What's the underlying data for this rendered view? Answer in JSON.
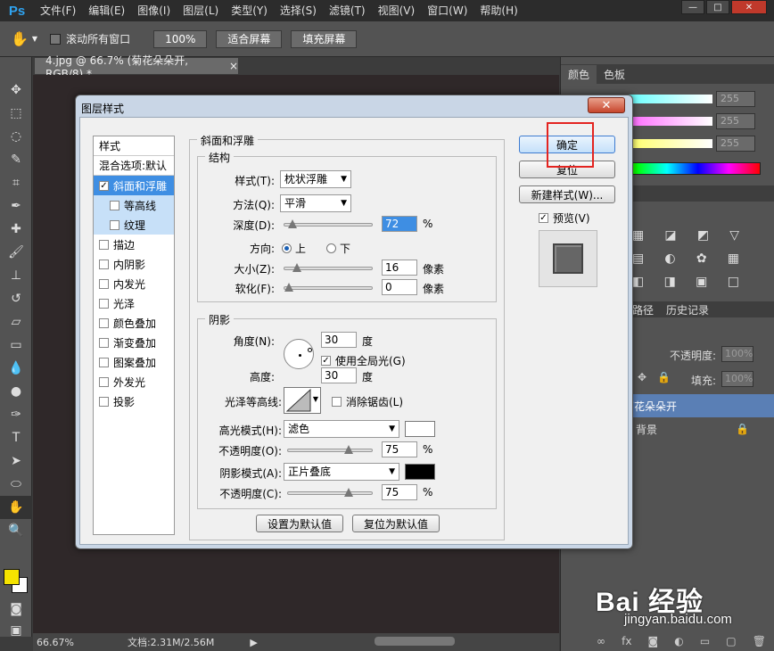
{
  "app": {
    "logo": "Ps"
  },
  "menu": [
    "文件(F)",
    "编辑(E)",
    "图像(I)",
    "图层(L)",
    "类型(Y)",
    "选择(S)",
    "滤镜(T)",
    "视图(V)",
    "窗口(W)",
    "帮助(H)"
  ],
  "window_controls": {
    "minimize": "—",
    "restore": "□",
    "close": "✕"
  },
  "options_bar": {
    "scroll_all_label": "滚动所有窗口",
    "zoom_button": "100%",
    "fit_screen_button": "适合屏幕",
    "fill_screen_button": "填充屏幕"
  },
  "document": {
    "tab_title": "4.jpg @ 66.7% (菊花朵朵开, RGB/8) *",
    "tab_close": "×"
  },
  "status": {
    "zoom": "66.67%",
    "doc_size": "文档:2.31M/2.56M"
  },
  "panels": {
    "color_tabs": [
      "颜色",
      "色板"
    ],
    "color_values": [
      "255",
      "255",
      "255"
    ],
    "history_tabs": [
      "路径",
      "历史记录"
    ],
    "opacity_label": "不透明度:",
    "opacity_value": "100%",
    "fill_label": "填充:",
    "fill_value": "100%",
    "layer_selected": "菊花朵朵开",
    "layer_background": "背景"
  },
  "dialog": {
    "title": "图层样式",
    "close": "✕",
    "style_list_header": "样式",
    "blend_options": "混合选项:默认",
    "effects": [
      {
        "label": "斜面和浮雕",
        "checked": true,
        "selected": true,
        "sub": false
      },
      {
        "label": "等高线",
        "checked": false,
        "selected": false,
        "sub": true
      },
      {
        "label": "纹理",
        "checked": false,
        "selected": false,
        "sub": true
      },
      {
        "label": "描边",
        "checked": false,
        "selected": false,
        "sub": false
      },
      {
        "label": "内阴影",
        "checked": false,
        "selected": false,
        "sub": false
      },
      {
        "label": "内发光",
        "checked": false,
        "selected": false,
        "sub": false
      },
      {
        "label": "光泽",
        "checked": false,
        "selected": false,
        "sub": false
      },
      {
        "label": "颜色叠加",
        "checked": false,
        "selected": false,
        "sub": false
      },
      {
        "label": "渐变叠加",
        "checked": false,
        "selected": false,
        "sub": false
      },
      {
        "label": "图案叠加",
        "checked": false,
        "selected": false,
        "sub": false
      },
      {
        "label": "外发光",
        "checked": false,
        "selected": false,
        "sub": false
      },
      {
        "label": "投影",
        "checked": false,
        "selected": false,
        "sub": false
      }
    ],
    "bevel": {
      "group_title": "斜面和浮雕",
      "structure_title": "结构",
      "style_label": "样式(T):",
      "style_value": "枕状浮雕",
      "technique_label": "方法(Q):",
      "technique_value": "平滑",
      "depth_label": "深度(D):",
      "depth_value": "72",
      "depth_level": 0.05,
      "percent": "%",
      "direction_label": "方向:",
      "direction_up": "上",
      "direction_down": "下",
      "size_label": "大小(Z):",
      "size_value": "16",
      "size_level": 0.1,
      "size_unit": "像素",
      "soften_label": "软化(F):",
      "soften_value": "0",
      "soften_level": 0.0,
      "soften_unit": "像素"
    },
    "shading": {
      "title": "阴影",
      "angle_label": "角度(N):",
      "angle_value": "30",
      "angle_unit": "度",
      "global_light_label": "使用全局光(G)",
      "altitude_label": "高度:",
      "altitude_value": "30",
      "altitude_unit": "度",
      "gloss_contour_label": "光泽等高线:",
      "anti_alias_label": "消除锯齿(L)",
      "highlight_mode_label": "高光模式(H):",
      "highlight_mode_value": "滤色",
      "highlight_color": "#ffffff",
      "highlight_opacity_label": "不透明度(O):",
      "highlight_opacity_value": "75",
      "highlight_opacity_level": 0.75,
      "shadow_mode_label": "阴影模式(A):",
      "shadow_mode_value": "正片叠底",
      "shadow_color": "#000000",
      "shadow_opacity_label": "不透明度(C):",
      "shadow_opacity_value": "75",
      "shadow_opacity_level": 0.75
    },
    "set_default_button": "设置为默认值",
    "reset_default_button": "复位为默认值",
    "ok_button": "确定",
    "reset_button": "复位",
    "new_style_button": "新建样式(W)...",
    "preview_label": "预览(V)"
  },
  "watermark": {
    "brand": "Bai 经验",
    "url": "jingyan.baidu.com"
  }
}
